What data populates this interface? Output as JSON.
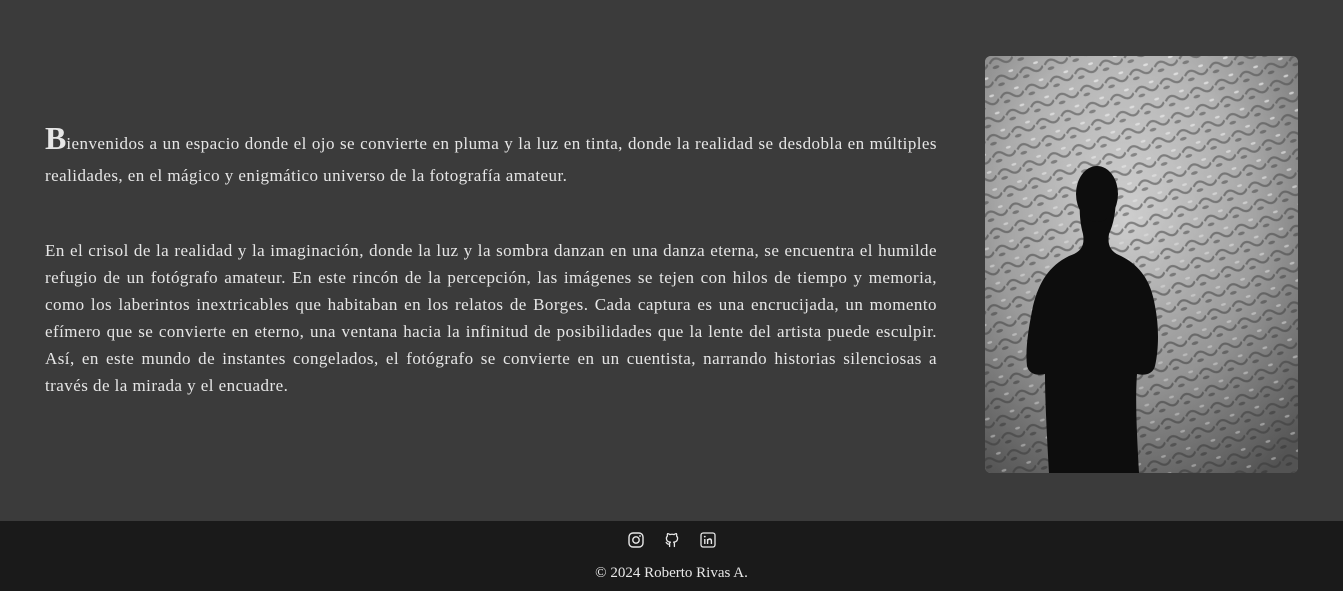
{
  "intro": {
    "dropcap": "B",
    "text": "ienvenidos a un espacio donde el ojo se convierte en pluma y la luz en tinta, donde la realidad se desdobla en múltiples realidades, en el mágico y enigmático universo de la fotografía amateur."
  },
  "body_paragraph": "En el crisol de la realidad y la imaginación, donde la luz y la sombra danzan en una danza eterna, se encuentra el humilde refugio de un fotógrafo amateur. En este rincón de la percepción, las imágenes se tejen con hilos de tiempo y memoria, como los laberintos inextricables que habitaban en los relatos de Borges. Cada captura es una encrucijada, un momento efímero que se convierte en eterno, una ventana hacia la infinitud de posibilidades que la lente del artista puede esculpir. Así, en este mundo de instantes congelados, el fotógrafo se convierte en un cuentista, narrando historias silenciosas a través de la mirada y el encuadre.",
  "footer": {
    "social_icons": [
      "instagram-icon",
      "github-icon",
      "linkedin-icon"
    ],
    "copyright": "© 2024 Roberto Rivas A."
  },
  "colors": {
    "background": "#3b3b3b",
    "footer_background": "#1a1a1a",
    "text": "#e6e6e6"
  }
}
